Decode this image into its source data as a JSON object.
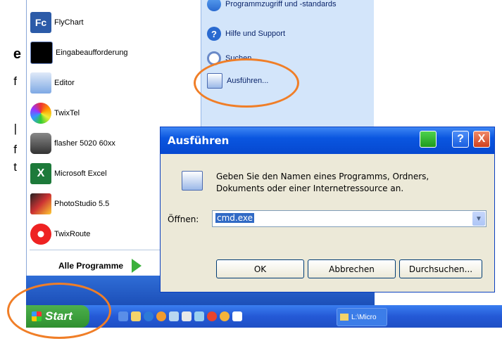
{
  "left_fragments": [
    "e",
    "f",
    "|",
    "f",
    "t"
  ],
  "start_menu": {
    "left_items": [
      {
        "label": "FlyChart",
        "icon": "flychart-icon"
      },
      {
        "label": "Eingabeaufforderung",
        "icon": "cmd-icon"
      },
      {
        "label": "Editor",
        "icon": "notepad-icon"
      },
      {
        "label": "TwixTel",
        "icon": "twixtel-icon"
      },
      {
        "label": "flasher 5020 60xx",
        "icon": "flasher-icon"
      },
      {
        "label": "Microsoft Excel",
        "icon": "excel-icon"
      },
      {
        "label": "PhotoStudio 5.5",
        "icon": "photostudio-icon"
      },
      {
        "label": "TwixRoute",
        "icon": "twixroute-icon"
      }
    ],
    "all_programs": "Alle Programme",
    "right_items": [
      {
        "label": "Programmzugriff und -standards"
      },
      {
        "label": "Hilfe und Support"
      },
      {
        "label": "Suchen"
      },
      {
        "label": "Ausführen..."
      }
    ]
  },
  "taskbar": {
    "start_label": "Start",
    "task_label": "L:\\Micro"
  },
  "dialog": {
    "title": "Ausführen",
    "help_label": "?",
    "close_label": "X",
    "description_line1": "Geben Sie den Namen eines Programms, Ordners,",
    "description_line2": "Dokuments oder einer Internetressource an.",
    "open_label": "Öffnen:",
    "open_value": "cmd.exe",
    "ok_label": "OK",
    "cancel_label": "Abbrechen",
    "browse_label": "Durchsuchen..."
  },
  "colors": {
    "highlight_circle": "#f07e27",
    "title_bar": "#0a56e0",
    "start_green": "#3b9b3b"
  }
}
